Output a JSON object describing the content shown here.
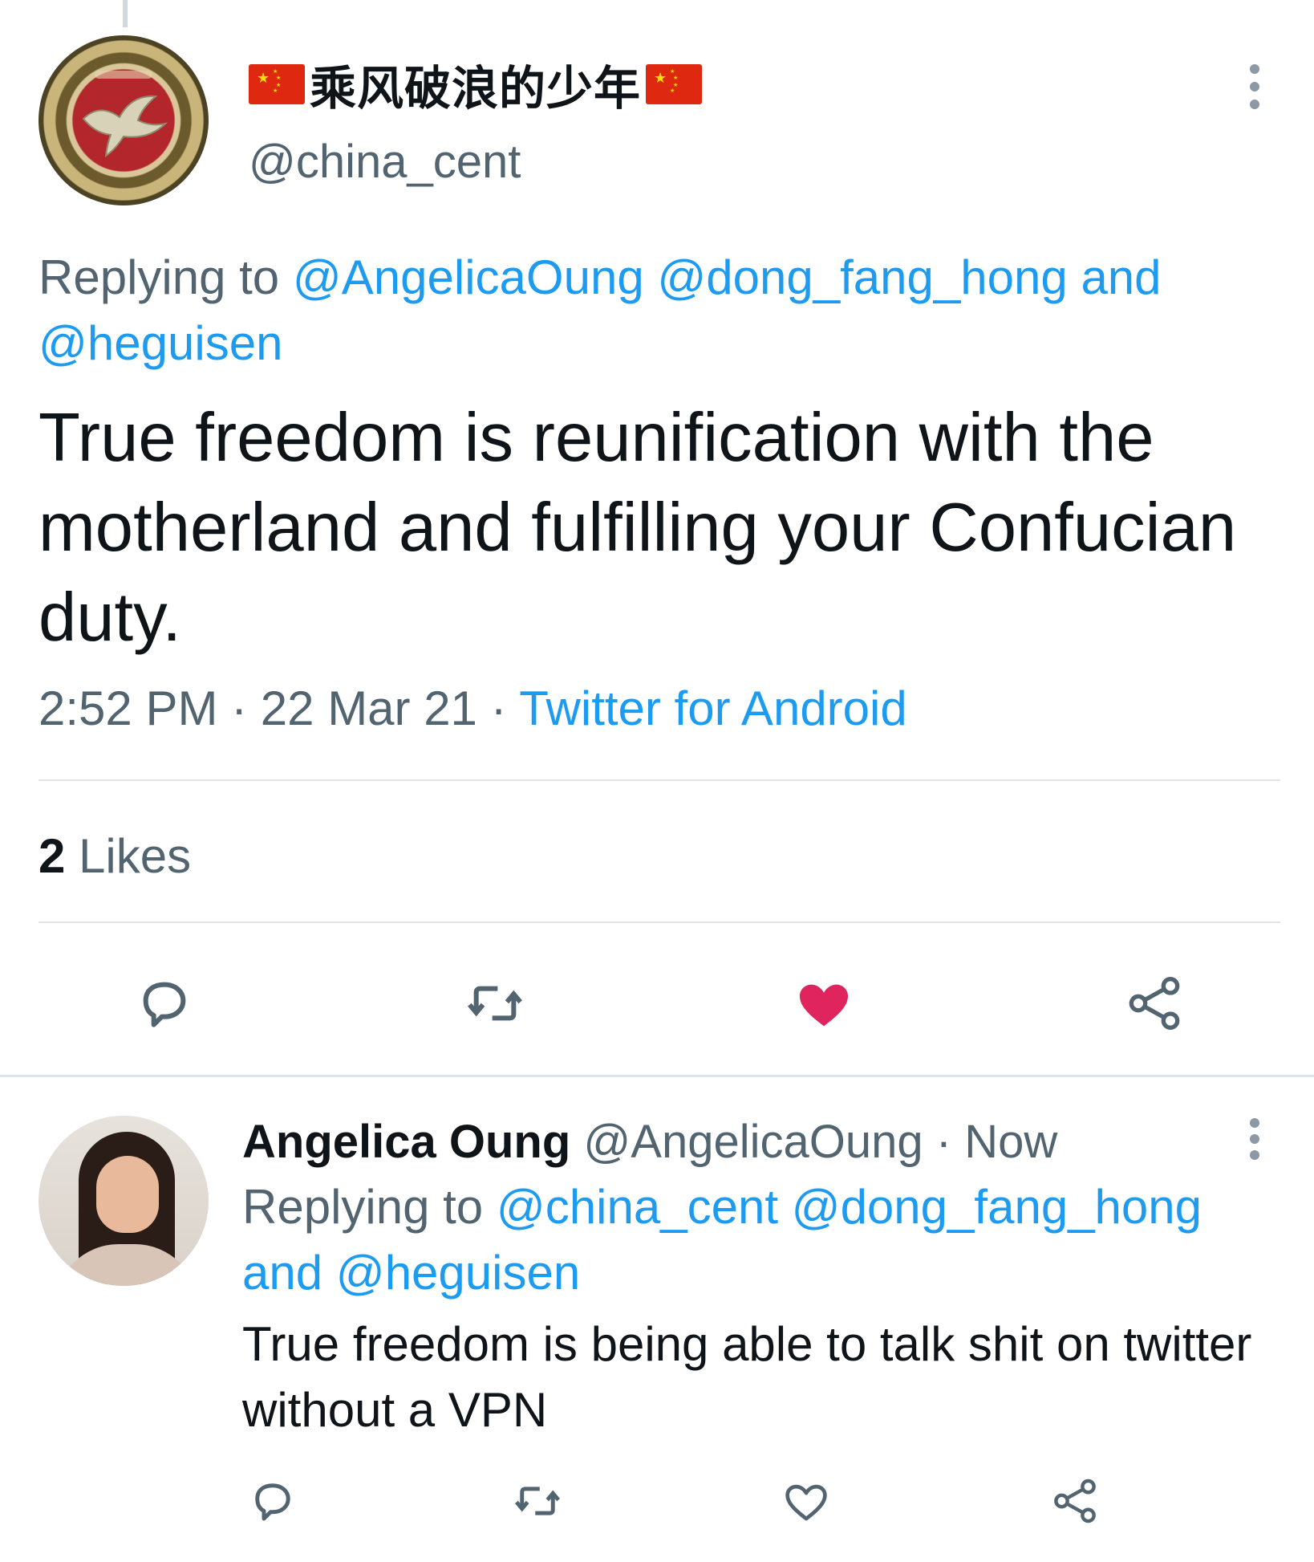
{
  "main_tweet": {
    "display_name": "乘风破浪的少年",
    "name_emoji_left": "china-flag",
    "name_emoji_right": "china-flag",
    "handle": "@china_cent",
    "replying_prefix": "Replying to",
    "replying_handles": [
      "@AngelicaOung",
      "@dong_fang_hong"
    ],
    "replying_and": "and",
    "replying_last": "@heguisen",
    "text": "True freedom is reunification with the motherland and fulfilling your Confucian duty.",
    "time": "2:52 PM",
    "separator": "·",
    "date": "22 Mar 21",
    "source": "Twitter for Android",
    "likes_count": "2",
    "likes_label": "Likes",
    "liked": true,
    "icons": [
      "reply-icon",
      "retweet-icon",
      "like-icon",
      "share-icon"
    ]
  },
  "reply_tweet": {
    "name": "Angelica Oung",
    "handle": "@AngelicaOung",
    "separator": "·",
    "time": "Now",
    "replying_prefix": "Replying to",
    "replying_handles": [
      "@china_cent",
      "@dong_fang_hong"
    ],
    "replying_and": "and",
    "replying_last": "@heguisen",
    "text": "True freedom is being able to talk shit on twitter without a VPN",
    "liked": false,
    "icons": [
      "reply-icon",
      "retweet-icon",
      "like-icon",
      "share-icon"
    ]
  },
  "colors": {
    "link": "#1d9bf0",
    "secondary_text": "#536471",
    "primary_text": "#0f1419",
    "like_active": "#e0245e",
    "icon_inactive": "#536471",
    "divider": "#dfe4e8"
  }
}
